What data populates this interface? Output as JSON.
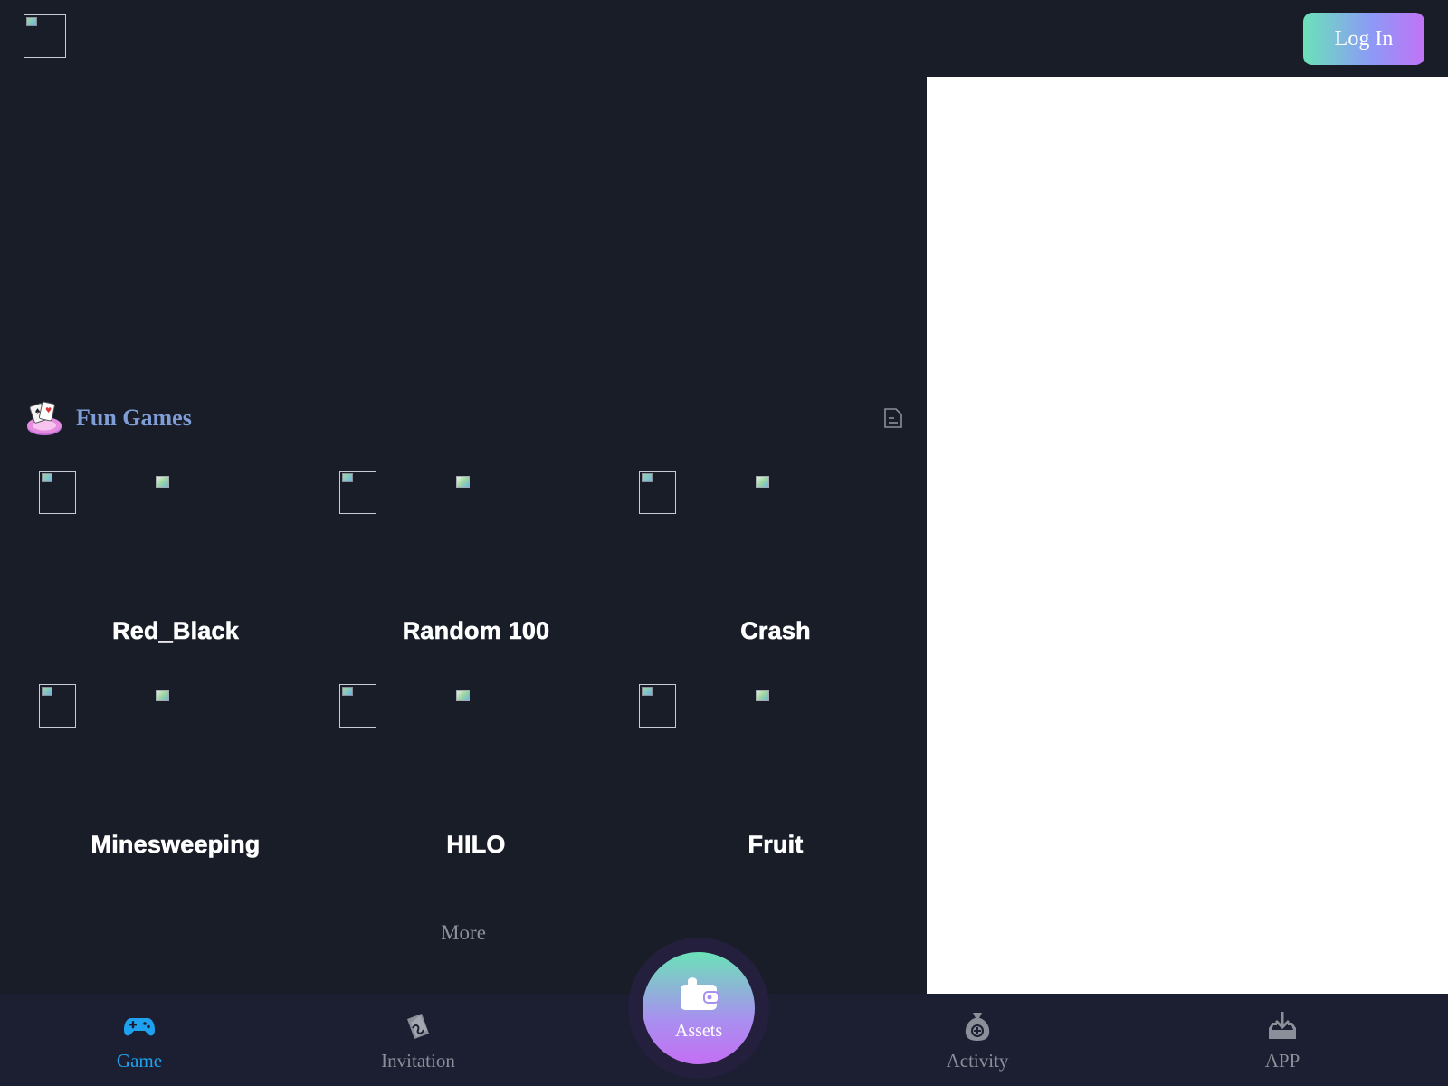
{
  "header": {
    "login_label": "Log In"
  },
  "section": {
    "title": "Fun Games"
  },
  "games": [
    {
      "name": "Red_Black"
    },
    {
      "name": "Random 100"
    },
    {
      "name": "Crash"
    },
    {
      "name": "Minesweeping"
    },
    {
      "name": "HILO"
    },
    {
      "name": "Fruit"
    }
  ],
  "more_label": "More",
  "bottom_nav": {
    "items": [
      {
        "label": "Game",
        "icon": "gamepad-icon"
      },
      {
        "label": "Invitation",
        "icon": "invitation-icon"
      },
      {
        "label": "Assets",
        "icon": "wallet-icon"
      },
      {
        "label": "Activity",
        "icon": "money-bag-icon"
      },
      {
        "label": "APP",
        "icon": "download-tray-icon"
      }
    ],
    "active": "Game"
  },
  "colors": {
    "background": "#181d27",
    "accent_blue": "#1ea1ee",
    "section_title": "#7f9ed8",
    "nav_inactive": "#8a8f99",
    "gradient_start": "#6be2b8",
    "gradient_end": "#c173f6"
  }
}
